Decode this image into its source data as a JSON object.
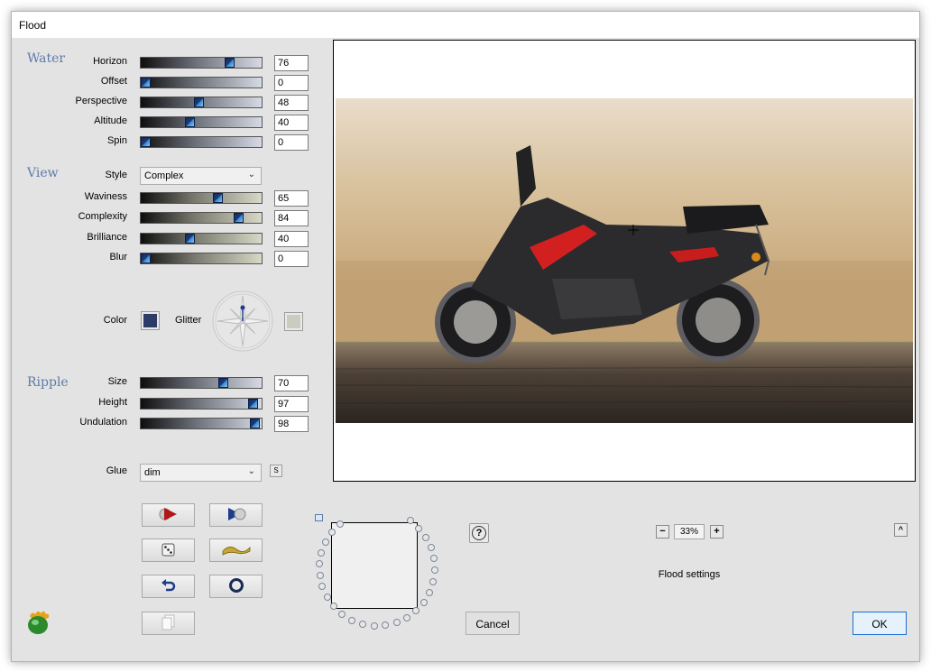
{
  "window": {
    "title": "Flood"
  },
  "water": {
    "heading": "Water",
    "sliders": [
      {
        "label": "Horizon",
        "value": "76"
      },
      {
        "label": "Offset",
        "value": "0"
      },
      {
        "label": "Perspective",
        "value": "48"
      },
      {
        "label": "Altitude",
        "value": "40"
      },
      {
        "label": "Spin",
        "value": "0"
      }
    ]
  },
  "view": {
    "heading": "View",
    "style_label": "Style",
    "style_value": "Complex",
    "sliders": [
      {
        "label": "Waviness",
        "value": "65"
      },
      {
        "label": "Complexity",
        "value": "84"
      },
      {
        "label": "Brilliance",
        "value": "40"
      },
      {
        "label": "Blur",
        "value": "0"
      }
    ],
    "color_label": "Color",
    "glitter_label": "Glitter",
    "colors": {
      "water": "#2c3c66",
      "glitter": "#cbcbc0"
    }
  },
  "ripple": {
    "heading": "Ripple",
    "sliders": [
      {
        "label": "Size",
        "value": "70"
      },
      {
        "label": "Height",
        "value": "97"
      },
      {
        "label": "Undulation",
        "value": "98"
      }
    ]
  },
  "glue": {
    "label": "Glue",
    "value": "dim",
    "side_button": "S"
  },
  "toolbar": {
    "icons": [
      "play-red-icon",
      "play-blue-icon",
      "dice-icon",
      "wave-icon",
      "undo-icon",
      "ring-icon",
      "copy-icon"
    ]
  },
  "help": {
    "label": "?"
  },
  "zoom": {
    "minus": "−",
    "value": "33%",
    "plus": "+",
    "collapse": "^"
  },
  "status_text": "Flood settings",
  "buttons": {
    "cancel": "Cancel",
    "ok": "OK"
  }
}
